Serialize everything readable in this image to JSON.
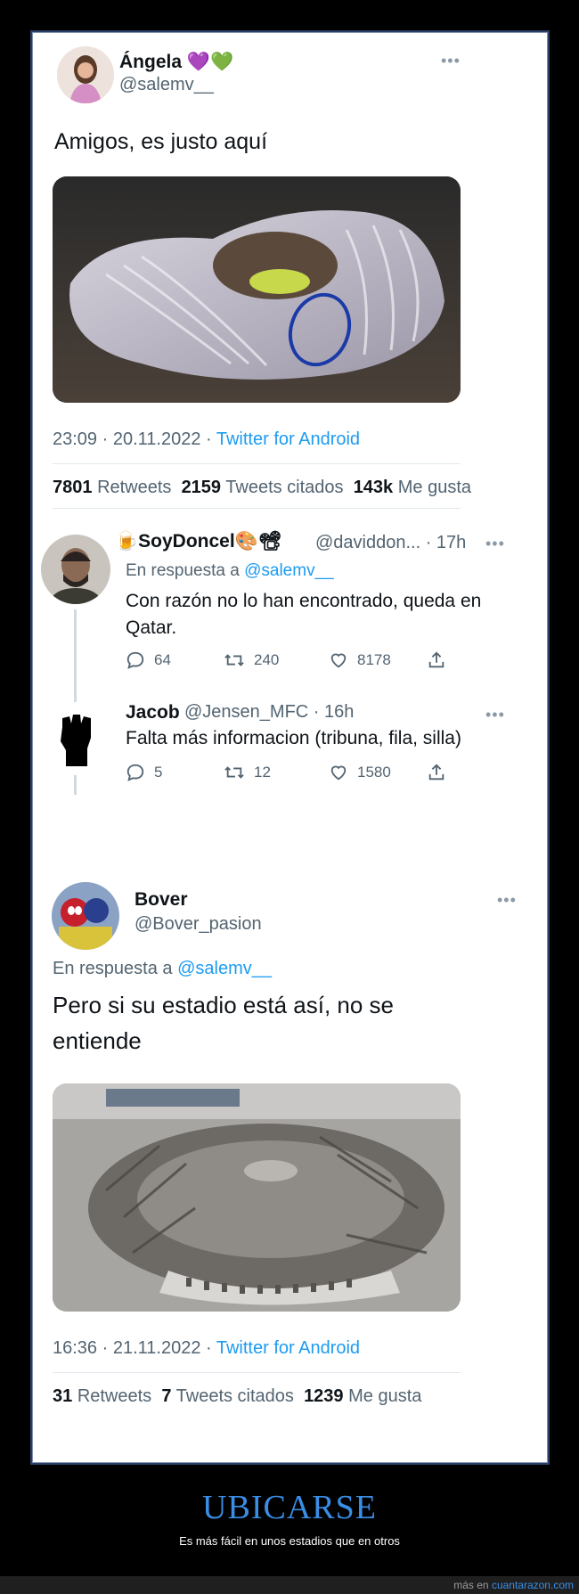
{
  "tweet1": {
    "name": "Ángela",
    "emoji": "💜💚",
    "handle": "@salemv__",
    "text": "Amigos, es justo aquí",
    "time": "23:09 · 20.11.2022 ·",
    "source": "Twitter for Android",
    "retweets_count": "7801",
    "retweets_label": "Retweets",
    "quotes_count": "2159",
    "quotes_label": "Tweets citados",
    "likes_count": "143k",
    "likes_label": "Me gusta"
  },
  "reply1": {
    "name": "SoyDoncel",
    "handle": "@daviddon... · 17h",
    "reply_to_label": "En respuesta a",
    "reply_to_handle": "@salemv__",
    "text_line1": "Con razón no lo han encontrado, queda en",
    "text_line2": "Qatar.",
    "replies": "64",
    "retweets": "240",
    "likes": "8178"
  },
  "reply2": {
    "name": "Jacob",
    "handle": "@Jensen_MFC · 16h",
    "text": "Falta más informacion (tribuna, fila, silla)",
    "replies": "5",
    "retweets": "12",
    "likes": "1580"
  },
  "tweet2": {
    "name": "Bover",
    "handle": "@Bover_pasion",
    "reply_to_label": "En respuesta a",
    "reply_to_handle": "@salemv__",
    "text_line1": "Pero si su estadio está así, no se",
    "text_line2": "entiende",
    "time": "16:36 · 21.11.2022 ·",
    "source": "Twitter for Android",
    "retweets_count": "31",
    "retweets_label": "Retweets",
    "quotes_count": "7",
    "quotes_label": "Tweets citados",
    "likes_count": "1239",
    "likes_label": "Me gusta"
  },
  "footer": {
    "title": "UBICARSE",
    "subtitle": "Es más fácil en unos estadios que en otros",
    "credit_prefix": "más en",
    "credit_site": "cuantarazon.com"
  },
  "colors": {
    "background": "#000000",
    "card": "#ffffff",
    "link": "#1d9bf0",
    "footer_title": "#3a8ee6"
  }
}
